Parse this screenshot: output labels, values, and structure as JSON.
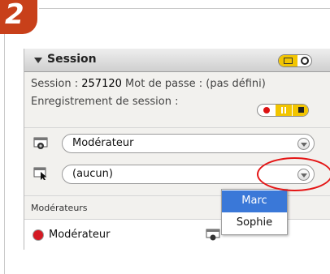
{
  "step": {
    "number": "2"
  },
  "panel": {
    "title": "Session",
    "session_label": "Session :",
    "session_id": "257120",
    "password_label": "Mot de passe :",
    "password_value": "(pas défini)",
    "recording_label": "Enregistrement de session :"
  },
  "roles": {
    "current_role": "Modérateur",
    "current_target": "(aucun)"
  },
  "list": {
    "section": "Modérateurs",
    "item": "Modérateur"
  },
  "dropdown": {
    "options": [
      "Marc",
      "Sophie"
    ],
    "selected": "Marc"
  },
  "colors": {
    "accent_yellow": "#f2c500",
    "record_red": "#d11111",
    "highlight_red": "#e41515",
    "selection_blue": "#3a78d8",
    "step_badge": "#c8401a"
  },
  "icons": [
    "collapse-triangle",
    "camera-icon",
    "cursor-screen-icon",
    "record-icon",
    "pause-icon",
    "stop-icon",
    "dropdown-arrow-icon",
    "user-status-dot"
  ]
}
